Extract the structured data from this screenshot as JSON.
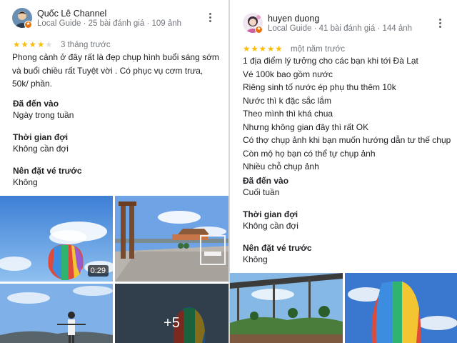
{
  "left_review": {
    "author": "Quốc Lê Channel",
    "author_meta": "Local Guide · 25 bài đánh giá · 109 ảnh",
    "rating": 4,
    "time": "3 tháng trước",
    "text": "Phong cảnh ở đây rất là đẹp chụp hình buổi sáng sớm và buổi chiều rất Tuyệt vời . Có phục vụ cơm trưa, 50k/ phần.",
    "visited_label": "Đã đến vào",
    "visited_value": "Ngày trong tuần",
    "wait_label": "Thời gian đợi",
    "wait_value": "Không cần đợi",
    "reserve_label": "Nên đặt vé trước",
    "reserve_value": "Không",
    "video_duration": "0:29",
    "more_photos": "+5"
  },
  "right_review": {
    "author": "huyen duong",
    "author_meta": "Local Guide · 41 bài đánh giá · 144 ảnh",
    "rating": 5,
    "time": "một năm trước",
    "lines": [
      "1 địa điểm lý tưởng cho các bạn khi tới Đà Lạt",
      "Vé 100k bao gồm nước",
      "Riêng sinh tố nước ép phụ thu thêm 10k",
      "Nước thì k đặc sắc lắm",
      "Theo mình thì khá chua",
      "Nhưng không gian đây thì rất OK",
      "Có thợ chụp ảnh khi bạn muốn hướng dẫn tư thế chụp",
      "Còn mộ họ bạn có thể tự chụp ảnh",
      "Nhiều chỗ chụp ảnh"
    ],
    "visited_label": "Đã đến vào",
    "visited_value": "Cuối tuần",
    "wait_label": "Thời gian đợi",
    "wait_value": "Không cần đợi",
    "reserve_label": "Nên đặt vé trước",
    "reserve_value": "Không"
  },
  "icons": {
    "more": "more-vert-icon",
    "star": "star-icon",
    "badge": "local-guide-badge-icon"
  },
  "colors": {
    "star": "#fbbc04",
    "meta": "#70757a",
    "badge": "#e8710a"
  }
}
